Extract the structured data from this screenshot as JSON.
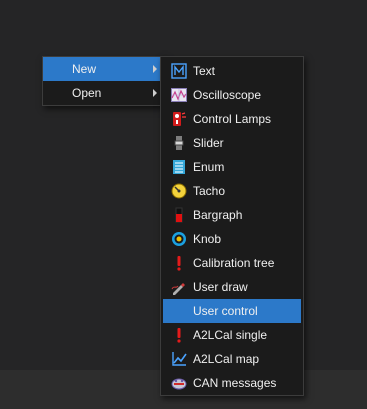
{
  "main_menu": {
    "items": [
      {
        "label": "New",
        "active": true
      },
      {
        "label": "Open",
        "active": false
      }
    ]
  },
  "sub_menu": {
    "items": [
      {
        "label": "Text",
        "icon": "text-icon"
      },
      {
        "label": "Oscilloscope",
        "icon": "oscilloscope-icon"
      },
      {
        "label": "Control Lamps",
        "icon": "control-lamps-icon"
      },
      {
        "label": "Slider",
        "icon": "slider-icon"
      },
      {
        "label": "Enum",
        "icon": "enum-icon"
      },
      {
        "label": "Tacho",
        "icon": "tacho-icon"
      },
      {
        "label": "Bargraph",
        "icon": "bargraph-icon"
      },
      {
        "label": "Knob",
        "icon": "knob-icon"
      },
      {
        "label": "Calibration tree",
        "icon": "calibration-tree-icon"
      },
      {
        "label": "User draw",
        "icon": "user-draw-icon"
      },
      {
        "label": "User control",
        "icon": "user-control-icon",
        "active": true
      },
      {
        "label": "A2LCal single",
        "icon": "a2lcal-single-icon"
      },
      {
        "label": "A2LCal map",
        "icon": "a2lcal-map-icon"
      },
      {
        "label": "CAN messages",
        "icon": "can-messages-icon"
      }
    ]
  },
  "colors": {
    "background": "#252526",
    "menu_background": "#1b1b1b",
    "highlight": "#2c79c9"
  }
}
